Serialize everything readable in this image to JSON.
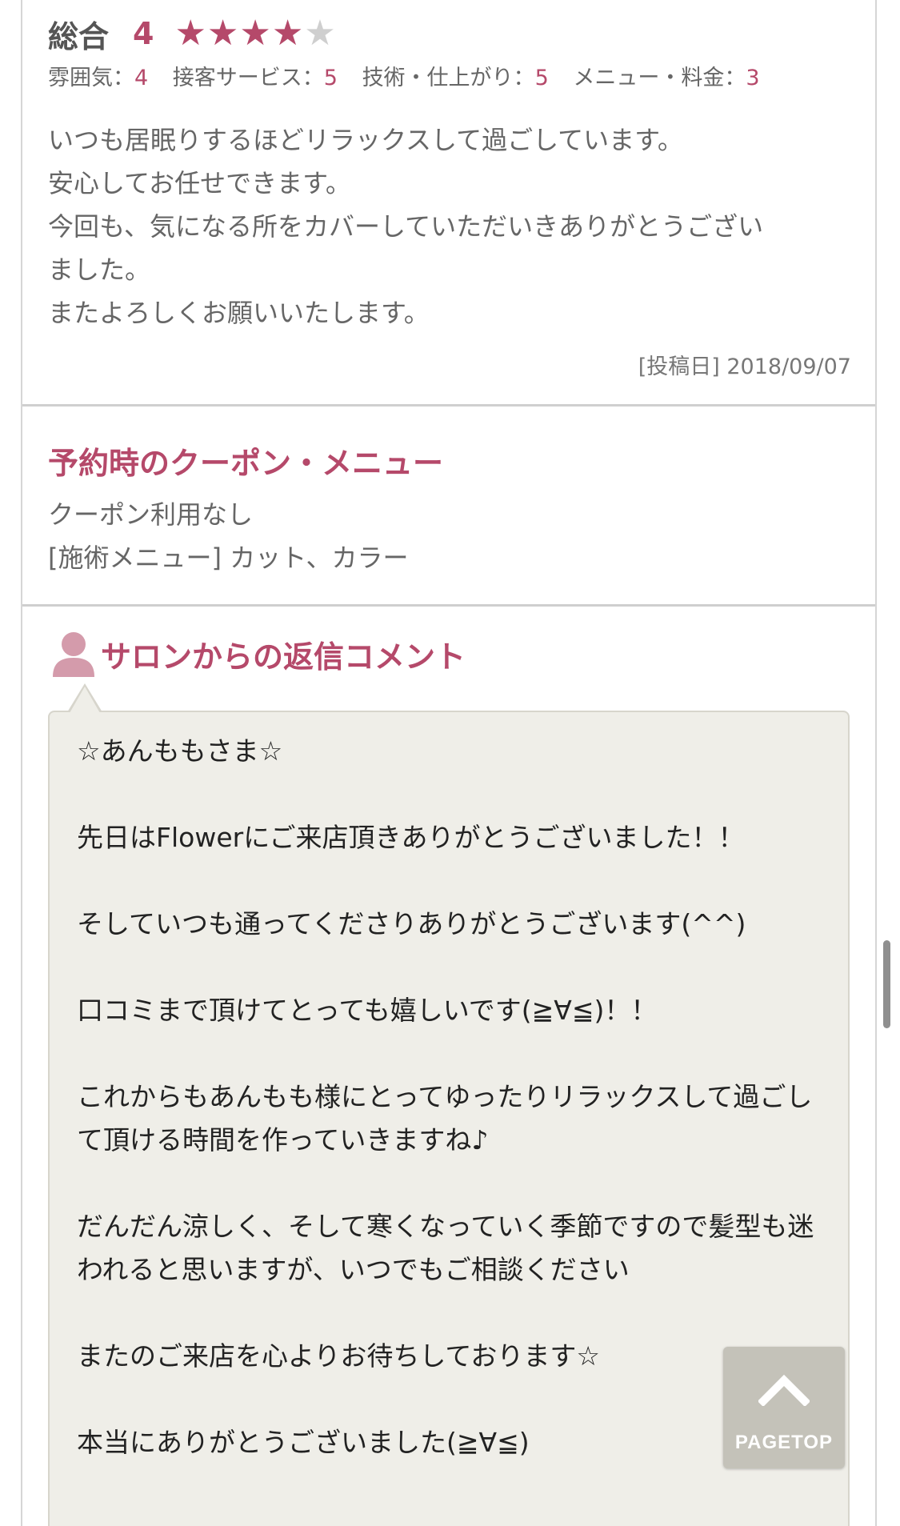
{
  "review": {
    "overall_label": "総合",
    "overall_score": "4",
    "stars_filled": 4,
    "stars_total": 5,
    "sub_ratings": [
      {
        "label": "雰囲気：",
        "value": "4"
      },
      {
        "label": "接客サービス：",
        "value": "5"
      },
      {
        "label": "技術・仕上がり：",
        "value": "5"
      },
      {
        "label": "メニュー・料金：",
        "value": "3"
      }
    ],
    "body_lines": [
      "いつも居眠りするほどリラックスして過ごしています。",
      "安心してお任せできます。",
      "今回も、気になる所をカバーしていただいきありがとうござい",
      "ました。",
      "またよろしくお願いいたします。"
    ],
    "post_date": "[投稿日] 2018/09/07"
  },
  "coupon": {
    "title": "予約時のクーポン・メニュー",
    "line1": "クーポン利用なし",
    "line2": "[施術メニュー] カット、カラー"
  },
  "reply": {
    "title": "サロンからの返信コメント",
    "paragraphs": [
      "☆あんももさま☆",
      "先日はFlowerにご来店頂きありがとうございました！！",
      "そしていつも通ってくださりありがとうございます(^^)",
      "口コミまで頂けてとっても嬉しいです(≧∀≦)！！",
      "これからもあんもも様にとってゆったりリラックスして過ごして頂ける時間を作っていきますね♪",
      "だんだん涼しく、そして寒くなっていく季節ですので髪型も迷われると思いますが、いつでもご相談ください",
      "またのご来店を心よりお待ちしております☆",
      "本当にありがとうございました(≧∀≦)"
    ]
  },
  "pagetop": {
    "label": "PAGETOP"
  },
  "colors": {
    "accent": "#b5496a",
    "bubble_bg": "#efeee8",
    "star_off": "#cfcfcf"
  },
  "icons": {
    "avatar": "person-icon",
    "pagetop": "chevron-up-icon"
  }
}
